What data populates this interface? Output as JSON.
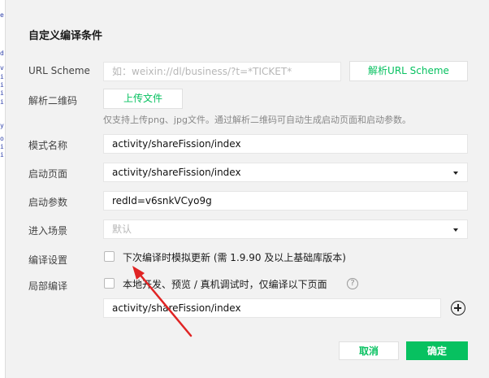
{
  "left_strip": {
    "chars": [
      "e",
      "d",
      "v",
      "i",
      "i",
      "i",
      "i",
      "y",
      "o",
      "i",
      "i"
    ]
  },
  "dialog": {
    "title": "自定义编译条件",
    "url_scheme": {
      "label": "URL Scheme",
      "placeholder": "如：weixin://dl/business/?t=*TICKET*",
      "parse_button": "解析URL Scheme"
    },
    "qr": {
      "label": "解析二维码",
      "upload_button": "上传文件",
      "hint": "仅支持上传png、jpg文件。通过解析二维码可自动生成启动页面和启动参数。"
    },
    "mode_name": {
      "label": "模式名称",
      "value": "activity/shareFission/index"
    },
    "start_page": {
      "label": "启动页面",
      "value": "activity/shareFission/index"
    },
    "start_params": {
      "label": "启动参数",
      "value": "redId=v6snkVCyo9g"
    },
    "scene": {
      "label": "进入场景",
      "value": "默认"
    },
    "compile_settings": {
      "label": "编译设置",
      "checkbox_label": "下次编译时模拟更新 (需 1.9.90 及以上基础库版本)",
      "checked": false
    },
    "partial_compile": {
      "label": "局部编译",
      "checkbox_label": "本地开发、预览 / 真机调试时，仅编译以下页面",
      "checked": false,
      "page_value": "activity/shareFission/index",
      "help_glyph": "?"
    },
    "footer": {
      "cancel": "取消",
      "confirm": "确定"
    }
  },
  "colors": {
    "accent": "#07c160",
    "annotation_arrow": "#e02424"
  }
}
